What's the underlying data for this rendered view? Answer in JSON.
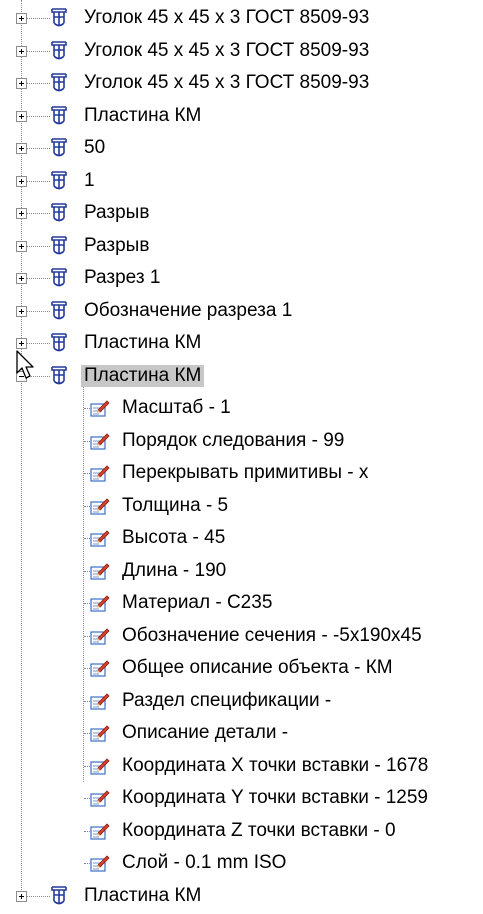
{
  "tree": {
    "top_nodes": [
      {
        "label": "Уголок 45 х 45 х 3 ГОСТ 8509-93"
      },
      {
        "label": "Уголок 45 х 45 х 3 ГОСТ 8509-93"
      },
      {
        "label": "Уголок 45 х 45 х 3 ГОСТ 8509-93"
      },
      {
        "label": "Пластина КМ"
      },
      {
        "label": "50"
      },
      {
        "label": "1"
      },
      {
        "label": "Разрыв"
      },
      {
        "label": "Разрыв"
      },
      {
        "label": "Разрез 1"
      },
      {
        "label": "Обозначение разреза  1"
      },
      {
        "label": "Пластина КМ"
      }
    ],
    "expanded_node": {
      "label": "Пластина КМ",
      "properties": [
        {
          "label": "Масштаб - 1"
        },
        {
          "label": "Порядок следования - 99"
        },
        {
          "label": "Перекрывать примитивы - х"
        },
        {
          "label": "Толщина - 5"
        },
        {
          "label": "Высота - 45"
        },
        {
          "label": "Длина - 190"
        },
        {
          "label": "Материал - С235"
        },
        {
          "label": "Обозначение сечения - -5х190х45"
        },
        {
          "label": "Общее описание объекта - КМ"
        },
        {
          "label": "Раздел спецификации -"
        },
        {
          "label": "Описание детали -"
        },
        {
          "label": "Координата X точки вставки - 1678"
        },
        {
          "label": "Координата Y точки вставки - 1259"
        },
        {
          "label": "Координата Z точки вставки - 0"
        },
        {
          "label": "Слой - 0.1 mm ISO"
        }
      ]
    },
    "last_node": {
      "label": "Пластина КМ"
    }
  },
  "icons": {
    "object": "object-node-icon",
    "property": "property-icon",
    "expand": "expand-plus-icon",
    "collapse": "collapse-minus-icon",
    "cursor": "mouse-cursor-icon"
  },
  "colors": {
    "selection": "#c7c7c7",
    "object_icon": "#243a9c",
    "property_icon_red": "#d8402f",
    "property_icon_blue": "#3b6fc6"
  }
}
